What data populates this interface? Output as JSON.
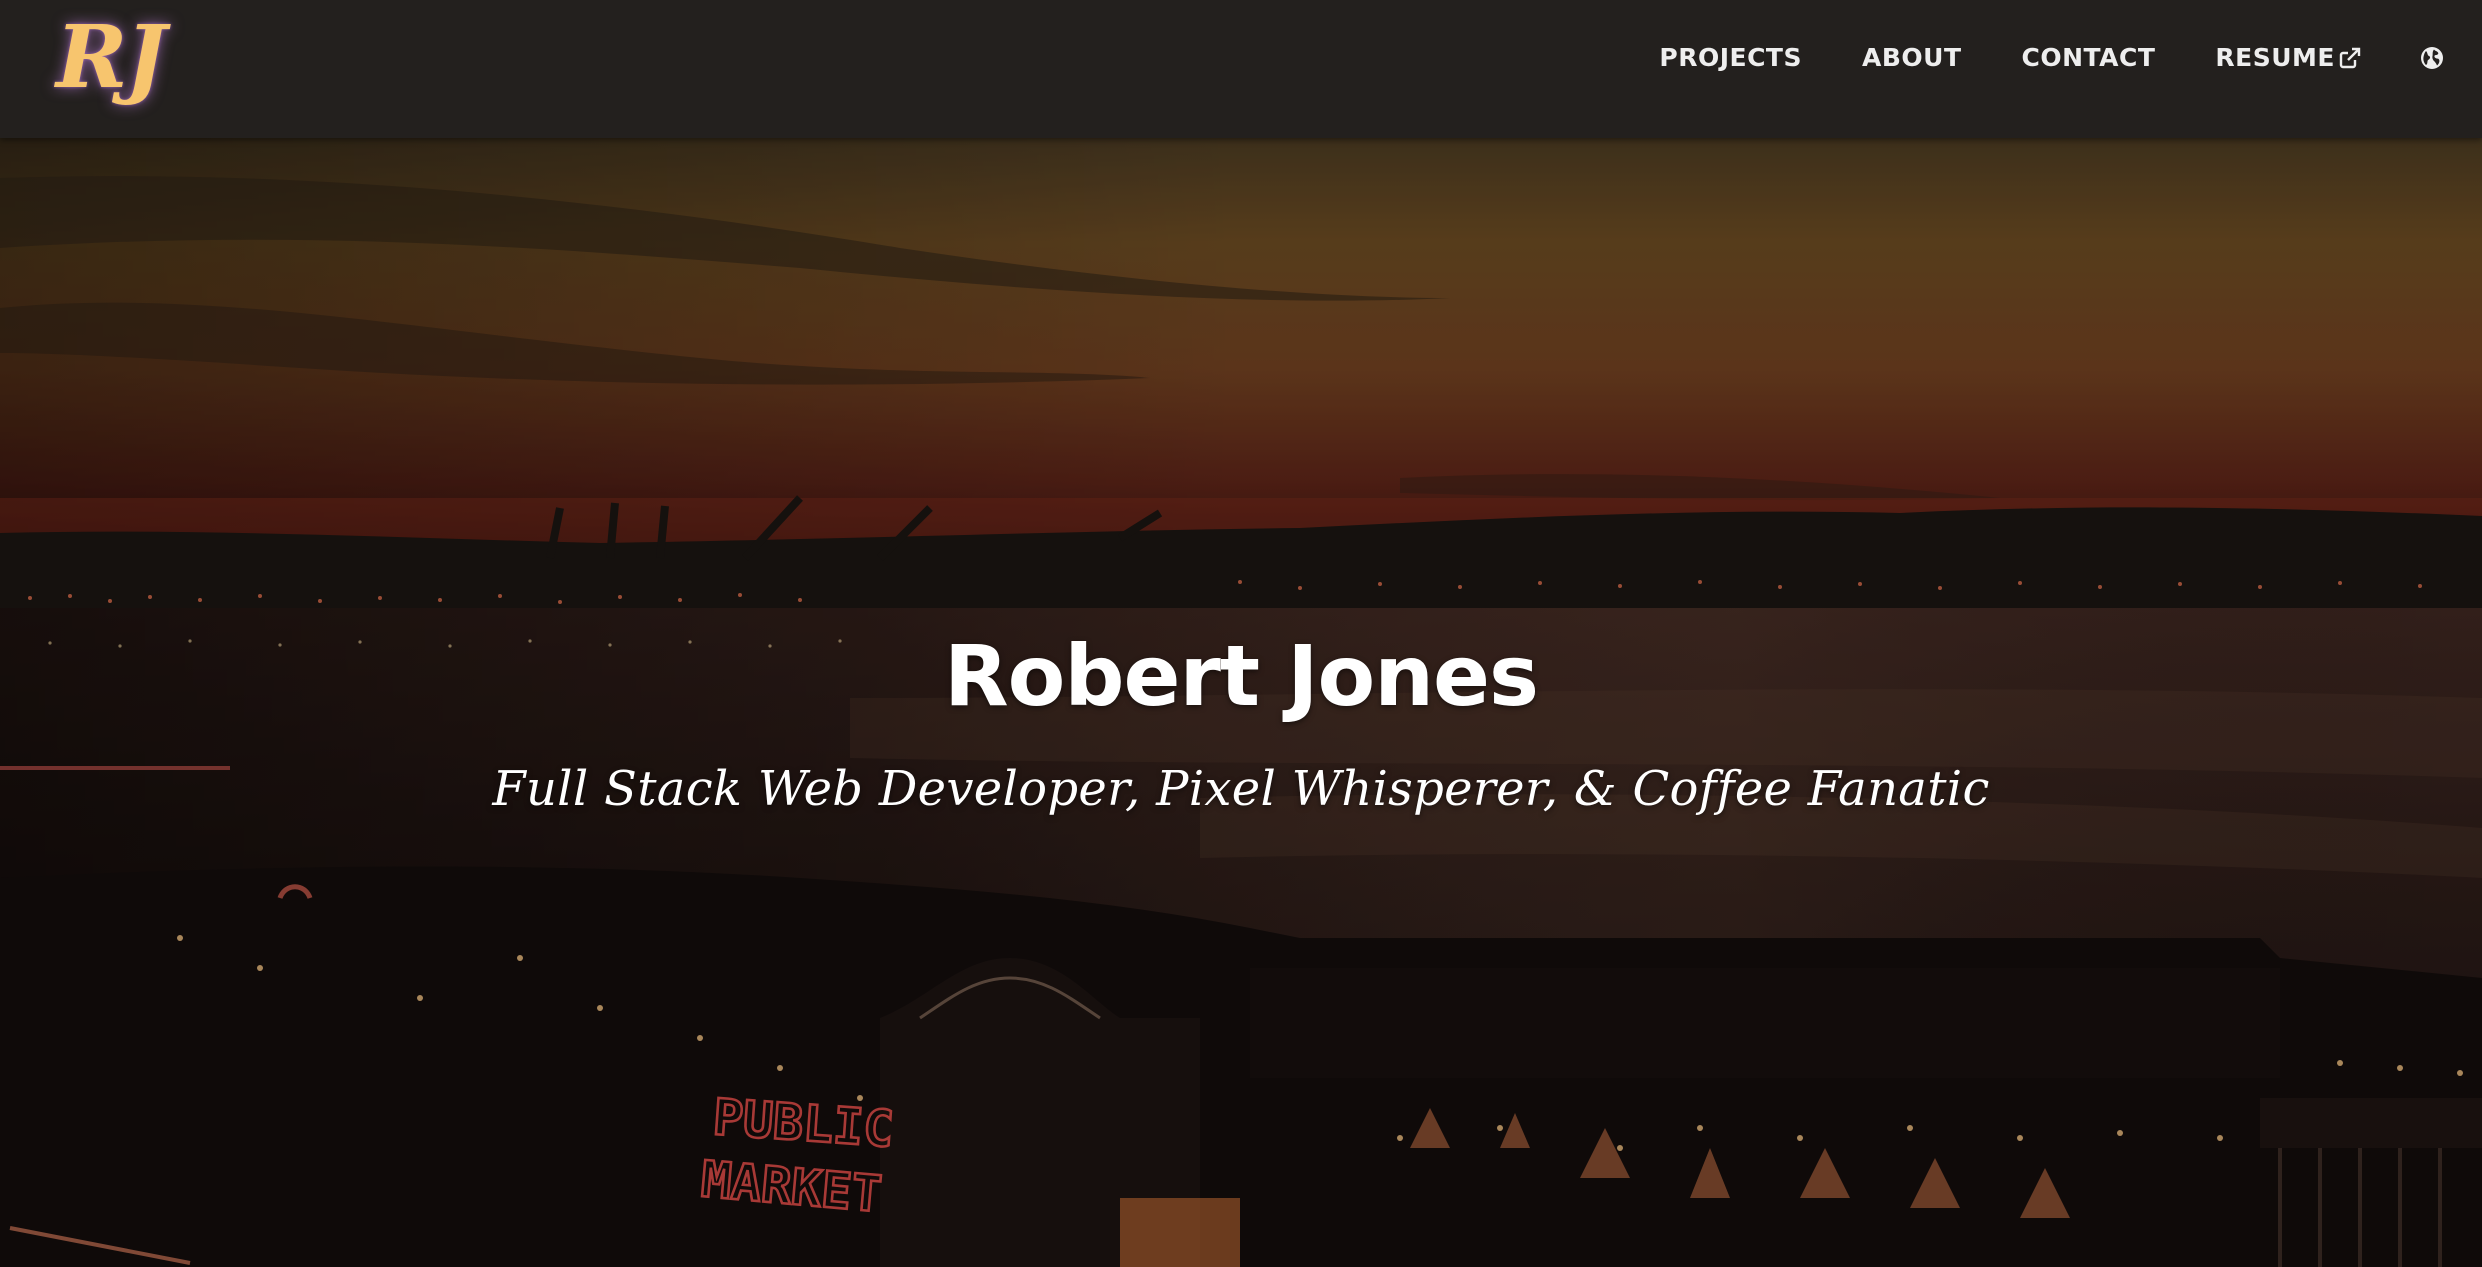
{
  "nav": {
    "logo": "RJ",
    "links": [
      {
        "label": "PROJECTS"
      },
      {
        "label": "ABOUT"
      },
      {
        "label": "CONTACT"
      },
      {
        "label": "RESUME",
        "icon": "external-link-icon"
      }
    ],
    "globe_icon": "globe-icon"
  },
  "hero": {
    "title": "Robert Jones",
    "subtitle": "Full Stack Web Developer, Pixel Whisperer, & Coffee Fanatic",
    "sign_line1": "PUBLIC",
    "sign_line2": "MARKET"
  },
  "colors": {
    "navbar_bg": "#23201e",
    "logo": "#f7c56e",
    "nav_text": "#eeeeee",
    "hero_text": "#ffffff",
    "sign_red": "#d94a46"
  }
}
